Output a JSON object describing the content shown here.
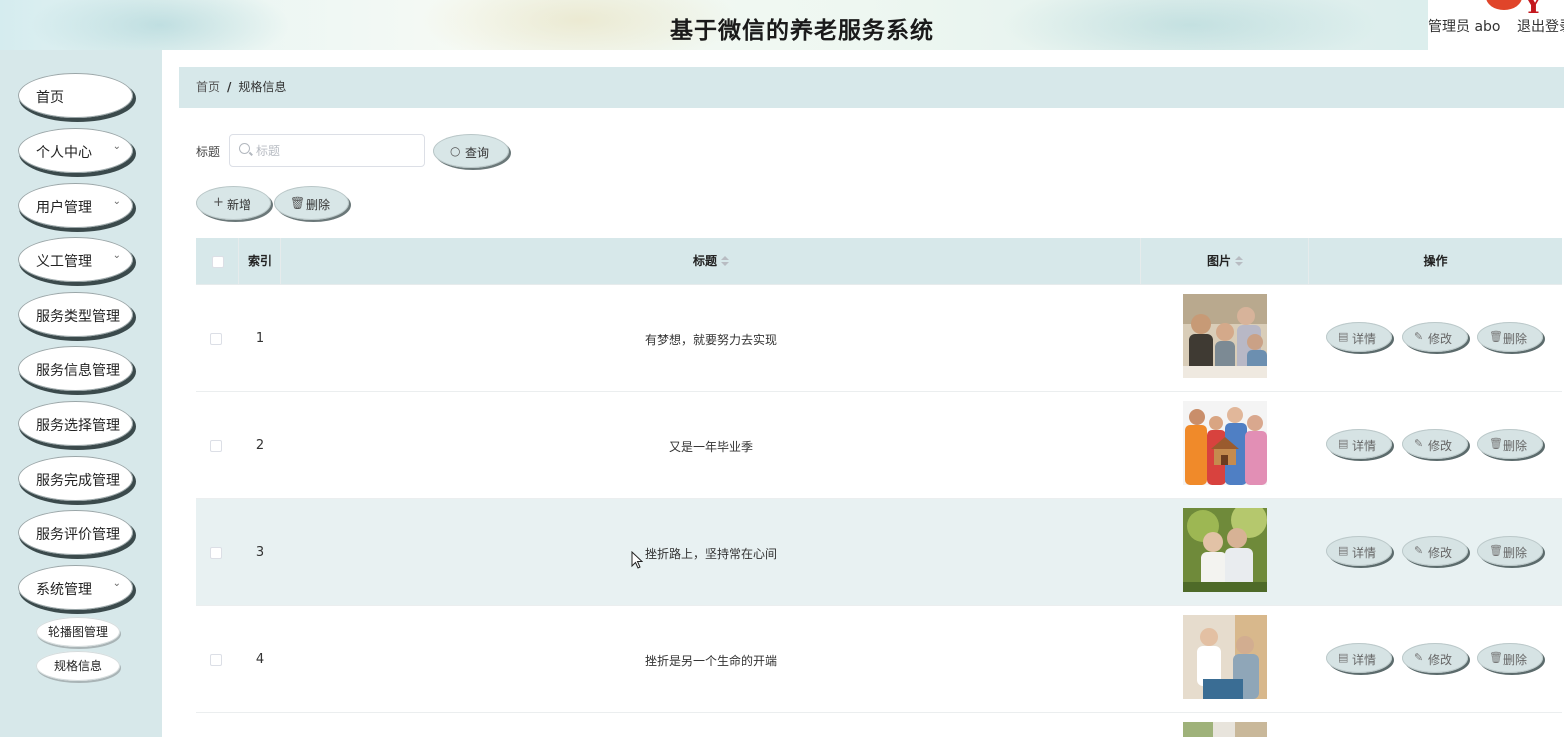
{
  "header": {
    "title": "基于微信的养老服务系统",
    "admin_label": "管理员 abo",
    "logout_label": "退出登录"
  },
  "sidebar": {
    "items": [
      {
        "label": "首页",
        "has_chevron": false
      },
      {
        "label": "个人中心",
        "has_chevron": true
      },
      {
        "label": "用户管理",
        "has_chevron": true
      },
      {
        "label": "义工管理",
        "has_chevron": true
      },
      {
        "label": "服务类型管理",
        "has_chevron": false
      },
      {
        "label": "服务信息管理",
        "has_chevron": false
      },
      {
        "label": "服务选择管理",
        "has_chevron": false
      },
      {
        "label": "服务完成管理",
        "has_chevron": false
      },
      {
        "label": "服务评价管理",
        "has_chevron": false
      },
      {
        "label": "系统管理",
        "has_chevron": true
      }
    ],
    "sub_items": [
      {
        "label": "轮播图管理"
      },
      {
        "label": "规格信息"
      }
    ]
  },
  "breadcrumb": {
    "home": "首页",
    "separator": "/",
    "current": "规格信息"
  },
  "search": {
    "label": "标题",
    "placeholder": "标题",
    "value": "",
    "query_button": "查询"
  },
  "toolbar": {
    "add_button": "新增",
    "delete_button": "删除"
  },
  "table": {
    "columns": {
      "index": "索引",
      "title": "标题",
      "image": "图片",
      "actions": "操作"
    },
    "rows": [
      {
        "index": "1",
        "title": "有梦想，就要努力去实现",
        "image": "elderly-friends-photo"
      },
      {
        "index": "2",
        "title": "又是一年毕业季",
        "image": "elderly-group-holding-house-photo"
      },
      {
        "index": "3",
        "title": "挫折路上，坚持常在心间",
        "image": "elderly-couple-outdoors-photo"
      },
      {
        "index": "4",
        "title": "挫折是另一个生命的开端",
        "image": "caregiver-with-elder-photo"
      }
    ],
    "row_actions": {
      "detail": "详情",
      "edit": "修改",
      "delete": "删除"
    }
  },
  "icons": {
    "search": "search-icon",
    "add": "plus-icon",
    "delete": "trash-icon",
    "detail": "document-icon",
    "edit": "pencil-icon",
    "chevron": "chevron-down-icon"
  },
  "colors": {
    "sidebar_bg": "#d7e8ea",
    "header_accent": "#c4181e",
    "button_fill": "#d8e6e7",
    "row_highlight": "#e8f1f2"
  }
}
